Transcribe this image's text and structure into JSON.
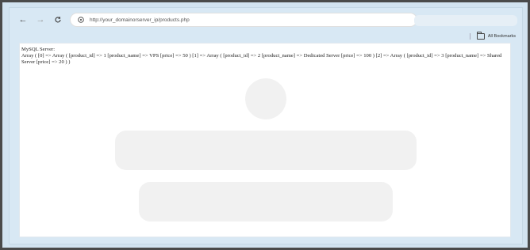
{
  "browser": {
    "url": "http://your_domainorserver_ip/products.php",
    "bookmarks_label": "All Bookmarks"
  },
  "icons": {
    "back": "back-arrow-icon",
    "forward": "forward-arrow-icon",
    "reload": "reload-icon",
    "site_info": "site-info-icon",
    "bookmarks": "folder-icon"
  },
  "page": {
    "line1": "MySQL Server:",
    "line2": "Array ( [0] => Array ( [product_id] => 1 [product_name] => VPS [price] => 50 ) [1] => Array ( [product_id] => 2 [product_name] => Dedicated Server [price] => 100 ) [2] => Array ( [product_id] => 3 [product_name] => Shared Server [price] => 20 ) )"
  }
}
